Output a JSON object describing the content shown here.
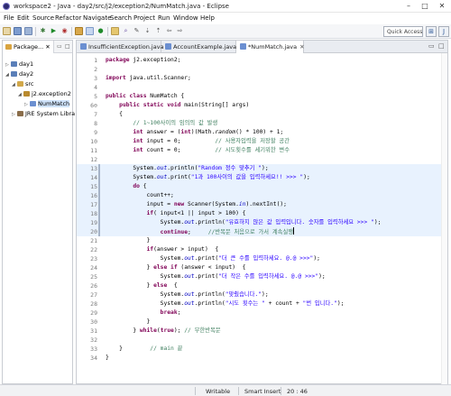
{
  "window": {
    "title": "workspace2 - Java - day2/src/j2/exception2/NumMatch.java - Eclipse",
    "minimize": "–",
    "maximize": "□",
    "close": "✕"
  },
  "menu": [
    "File",
    "Edit",
    "Source",
    "Refactor",
    "Navigate",
    "Search",
    "Project",
    "Run",
    "Window",
    "Help"
  ],
  "toolbar": {
    "quick_access_placeholder": "Quick Access"
  },
  "explorer": {
    "tab_label": "Package...",
    "close": "✕",
    "tree": [
      {
        "label": "day1",
        "depth": 0,
        "arrow": "▷",
        "icon": "project-icon"
      },
      {
        "label": "day2",
        "depth": 0,
        "arrow": "◢",
        "icon": "project-icon"
      },
      {
        "label": "src",
        "depth": 1,
        "arrow": "◢",
        "icon": "source-folder-icon"
      },
      {
        "label": "j2.exception2",
        "depth": 2,
        "arrow": "◢",
        "icon": "package-icon"
      },
      {
        "label": "NumMatch",
        "depth": 3,
        "arrow": "▷",
        "icon": "java-file-icon"
      },
      {
        "label": "JRE System Libra",
        "depth": 1,
        "arrow": "▷",
        "icon": "library-icon"
      }
    ]
  },
  "editor": {
    "tabs": [
      {
        "label": "InsufficientException.java",
        "active": false
      },
      {
        "label": "AccountExample.java",
        "active": false
      },
      {
        "label": "*NumMatch.java",
        "active": true
      }
    ],
    "tab_close": "✕",
    "overflow": "»",
    "lines": [
      {
        "n": "1",
        "html": "<span class=\"kw\">package</span> j2.exception2;"
      },
      {
        "n": "2",
        "html": ""
      },
      {
        "n": "3",
        "html": "<span class=\"kw\">import</span> java.util.Scanner;"
      },
      {
        "n": "4",
        "html": ""
      },
      {
        "n": "5",
        "html": "<span class=\"kw\">public class</span> NumMatch {"
      },
      {
        "n": "6⊖",
        "html": "    <span class=\"kw\">public static void</span> main(String[] args)"
      },
      {
        "n": "7",
        "html": "    {"
      },
      {
        "n": "8",
        "html": "        <span class=\"cm\">// 1~100사이의 임의의 값 발생</span>"
      },
      {
        "n": "9",
        "html": "        <span class=\"kw\">int</span> answer = (<span class=\"kw\">int</span>)(Math.<span class=\"itl\">random</span>() * 100) + 1;"
      },
      {
        "n": "10",
        "html": "        <span class=\"kw\">int</span> input = 0;          <span class=\"cm\">// 사용자입력을 저장할 공간</span>"
      },
      {
        "n": "11",
        "html": "        <span class=\"kw\">int</span> count = 0;          <span class=\"cm\">// 시도횟수를 세기위한 변수</span>"
      },
      {
        "n": "12",
        "html": ""
      },
      {
        "n": "13",
        "html": "        System.<span class=\"fld\">out</span>.println(<span class=\"str\">\"Random 정수 맞추기 \"</span>);"
      },
      {
        "n": "14",
        "html": "        System.<span class=\"fld\">out</span>.print(<span class=\"str\">\"1과 100사이의 값을 입력하세요!! >>> \"</span>);"
      },
      {
        "n": "15",
        "html": "        <span class=\"kw\">do</span> {"
      },
      {
        "n": "16",
        "html": "            count++;"
      },
      {
        "n": "17",
        "html": "            input = <span class=\"kw\">new</span> Scanner(System.<span class=\"fld\">in</span>).nextInt();"
      },
      {
        "n": "18",
        "html": "            <span class=\"kw\">if</span>( input<1 || input > 100) {"
      },
      {
        "n": "19",
        "html": "                System.<span class=\"fld\">out</span>.println(<span class=\"str\">\"유효하지 않은 값 입력입니다. 숫자를 입력하세요 >>> \"</span>);"
      },
      {
        "n": "20",
        "html": "                <span class=\"kw\">continue</span>;     <span class=\"cm\">//반복문 처음으로 가서 계속실행</span><span class=\"cursor\"></span>"
      },
      {
        "n": "21",
        "html": "            }"
      },
      {
        "n": "22",
        "html": "            <span class=\"kw\">if</span>(answer > input)  {"
      },
      {
        "n": "23",
        "html": "                System.<span class=\"fld\">out</span>.print(<span class=\"str\">\"더 큰 수를 입력하세요. @.@ >>>\"</span>);"
      },
      {
        "n": "24",
        "html": "            } <span class=\"kw\">else if</span> (answer < input)  {"
      },
      {
        "n": "25",
        "html": "                System.<span class=\"fld\">out</span>.print(<span class=\"str\">\"더 작은 수를 입력하세요. @.@ >>>\"</span>);"
      },
      {
        "n": "26",
        "html": "            } <span class=\"kw\">else</span>  {"
      },
      {
        "n": "27",
        "html": "                System.<span class=\"fld\">out</span>.println(<span class=\"str\">\"맞췄습니다.\"</span>);"
      },
      {
        "n": "28",
        "html": "                System.<span class=\"fld\">out</span>.println(<span class=\"str\">\"시도 횟수는 \"</span> + count + <span class=\"str\">\"번 입니다.\"</span>);"
      },
      {
        "n": "29",
        "html": "                <span class=\"kw\">break</span>;"
      },
      {
        "n": "30",
        "html": "            }"
      },
      {
        "n": "31",
        "html": "        } <span class=\"kw\">while</span>(<span class=\"kw\">true</span>); <span class=\"cm\">// 무한반복문</span>"
      },
      {
        "n": "32",
        "html": ""
      },
      {
        "n": "33",
        "html": "    }        <span class=\"cm\">// main 끝</span>"
      },
      {
        "n": "34",
        "html": "}"
      }
    ],
    "highlight_start": 13,
    "highlight_end": 20
  },
  "status": {
    "mode": "Writable",
    "insert": "Smart Insert",
    "position": "20 : 46"
  }
}
